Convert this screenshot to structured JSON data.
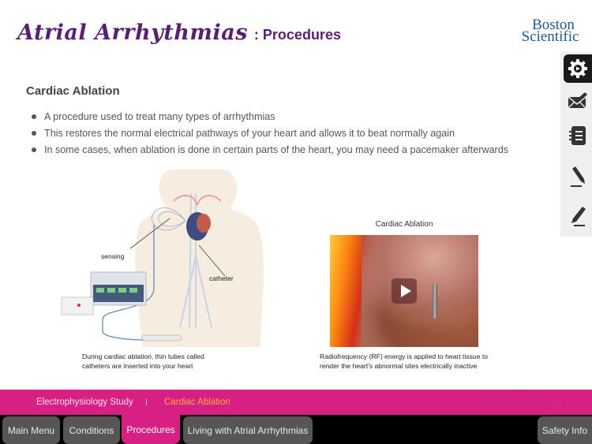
{
  "header": {
    "title": "Atrial Arrhythmias",
    "subtitle": ": Procedures",
    "logo_line1": "Boston",
    "logo_line2": "Scientific"
  },
  "toolbar": {
    "items": [
      {
        "icon": "gear-icon",
        "active": true
      },
      {
        "icon": "mail-icon",
        "active": false
      },
      {
        "icon": "notebook-icon",
        "active": false
      },
      {
        "icon": "pencil-down-icon",
        "active": false
      },
      {
        "icon": "pencil-up-icon",
        "active": false
      }
    ]
  },
  "content": {
    "section_title": "Cardiac Ablation",
    "bullets": [
      "A procedure used to treat many types of arrhythmias",
      "This restores the normal electrical pathways of your heart and allows it to beat normally again",
      "In some cases, when ablation is done in certain parts of the heart, you may need a pacemaker afterwards"
    ],
    "illustration": {
      "label_sensing": "sensing",
      "label_catheter": "catheter",
      "caption_line1": "During cardiac ablation, thin tubes called",
      "caption_line2": "catheters are inserted into your heart"
    },
    "video": {
      "title": "Cardiac Ablation",
      "caption_line1": "Radiofrequency (RF) energy is applied to heart tissue to",
      "caption_line2": "render the heart's abnormal sites electrically inactive"
    }
  },
  "breadcrumb": {
    "items": [
      "Electrophysiology Study",
      "Cardiac Ablation"
    ],
    "active_color": "#f7b233",
    "code": "CRV-6201-AC NOV2013"
  },
  "tabs": {
    "items": [
      {
        "label": "Main Menu",
        "active": false
      },
      {
        "label": "Conditions",
        "active": false
      },
      {
        "label": "Procedures",
        "active": true
      },
      {
        "label": "Living with Atrial Arrhythmias",
        "active": false
      }
    ],
    "right": "Safety Info"
  },
  "colors": {
    "brand_purple": "#5a1f73",
    "accent_magenta": "#d81f83",
    "logo_blue": "#1c5a9c"
  }
}
